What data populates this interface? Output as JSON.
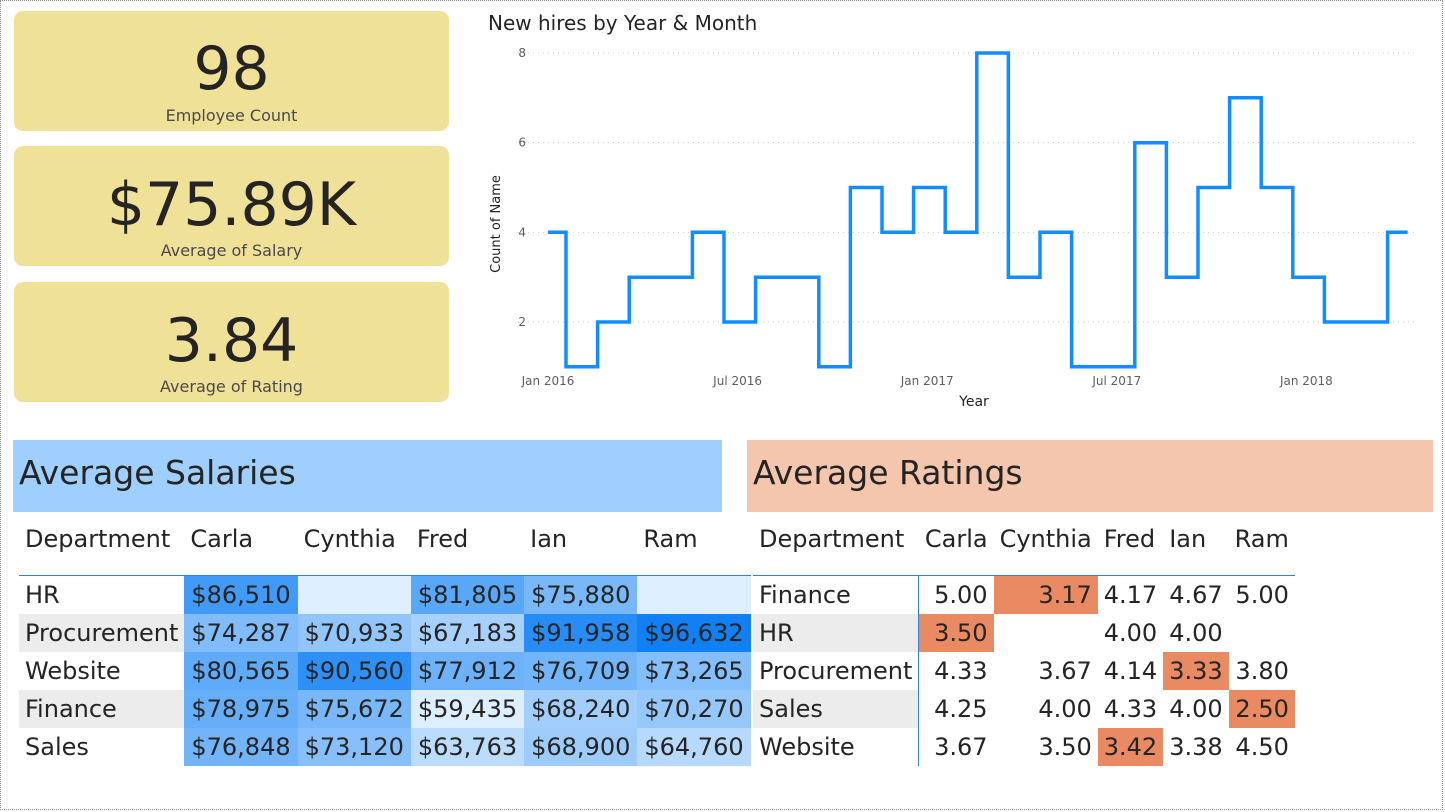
{
  "kpis": [
    {
      "value": "98",
      "label": "Employee Count"
    },
    {
      "value": "$75.89K",
      "label": "Average of Salary"
    },
    {
      "value": "3.84",
      "label": "Average of Rating"
    }
  ],
  "colors": {
    "kpi_bg": "#f0e199",
    "salary_header": "#9ecfff",
    "rating_header": "#f4c6ae",
    "line": "#118dff",
    "rating_highlight": "#ea8a62"
  },
  "chart_data": {
    "type": "line",
    "title": "New hires by Year & Month",
    "xlabel": "Year",
    "ylabel": "Count of Name",
    "x_tick_labels": [
      "Jan 2016",
      "Jul 2016",
      "Jan 2017",
      "Jul 2017",
      "Jan 2018"
    ],
    "y_ticks": [
      2,
      4,
      6,
      8
    ],
    "ylim": [
      0.5,
      8
    ],
    "step": true,
    "grid": true,
    "series": [
      {
        "x": [
          "2016-01",
          "2016-02",
          "2016-03",
          "2016-04",
          "2016-05",
          "2016-06",
          "2016-07",
          "2016-08",
          "2016-09",
          "2016-10",
          "2016-11",
          "2016-12",
          "2017-01",
          "2017-02",
          "2017-03",
          "2017-04",
          "2017-05",
          "2017-06",
          "2017-07",
          "2017-08",
          "2017-09",
          "2017-10",
          "2017-11",
          "2017-12",
          "2018-01",
          "2018-02",
          "2018-03",
          "2018-04"
        ],
        "values": [
          4,
          1,
          2,
          3,
          3,
          4,
          2,
          3,
          3,
          1,
          5,
          4,
          5,
          4,
          8,
          3,
          4,
          1,
          1,
          6,
          3,
          5,
          7,
          5,
          3,
          2,
          2,
          4
        ]
      }
    ]
  },
  "salaries": {
    "title": "Average Salaries",
    "columns": [
      "Department",
      "Carla",
      "Cynthia",
      "Fred",
      "Ian",
      "Ram"
    ],
    "rows": [
      {
        "dept": "HR",
        "values": [
          "$86,510",
          "",
          "$81,805",
          "$75,880",
          ""
        ]
      },
      {
        "dept": "Procurement",
        "values": [
          "$74,287",
          "$70,933",
          "$67,183",
          "$91,958",
          "$96,632"
        ]
      },
      {
        "dept": "Website",
        "values": [
          "$80,565",
          "$90,560",
          "$77,912",
          "$76,709",
          "$73,265"
        ]
      },
      {
        "dept": "Finance",
        "values": [
          "$78,975",
          "$75,672",
          "$59,435",
          "$68,240",
          "$70,270"
        ]
      },
      {
        "dept": "Sales",
        "values": [
          "$76,848",
          "$73,120",
          "$63,763",
          "$68,900",
          "$64,760"
        ]
      }
    ]
  },
  "ratings": {
    "title": "Average Ratings",
    "columns": [
      "Department",
      "Carla",
      "Cynthia",
      "Fred",
      "Ian",
      "Ram"
    ],
    "rows": [
      {
        "dept": "Finance",
        "values": [
          "5.00",
          "3.17",
          "4.17",
          "4.67",
          "5.00"
        ]
      },
      {
        "dept": "HR",
        "values": [
          "3.50",
          "",
          "4.00",
          "4.00",
          ""
        ]
      },
      {
        "dept": "Procurement",
        "values": [
          "4.33",
          "3.67",
          "4.14",
          "3.33",
          "3.80"
        ]
      },
      {
        "dept": "Sales",
        "values": [
          "4.25",
          "4.00",
          "4.33",
          "4.00",
          "2.50"
        ]
      },
      {
        "dept": "Website",
        "values": [
          "3.67",
          "3.50",
          "3.42",
          "3.38",
          "4.50"
        ]
      }
    ]
  }
}
